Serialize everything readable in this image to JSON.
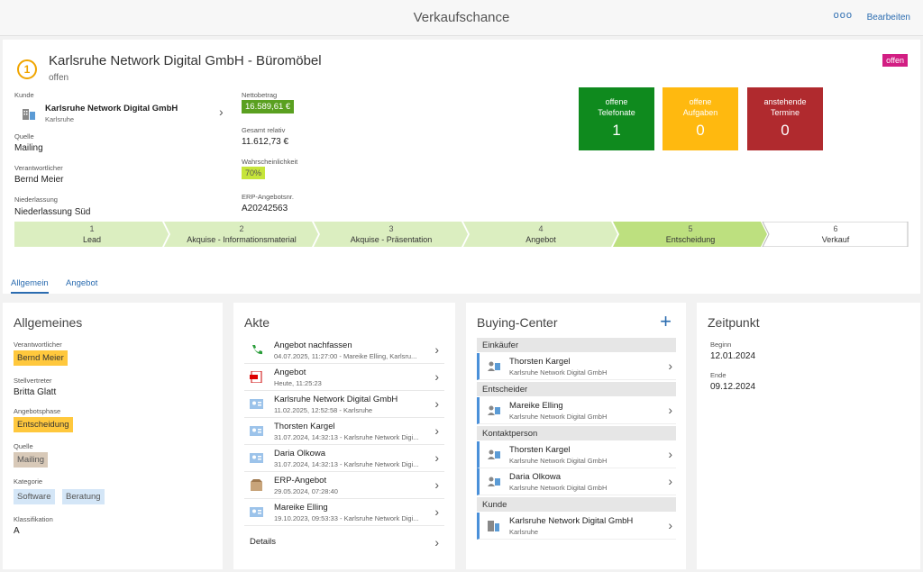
{
  "topbar": {
    "title": "Verkaufschance",
    "more": "ooo",
    "edit": "Bearbeiten"
  },
  "header": {
    "step_icon": "1",
    "title": "Karlsruhe Network Digital GmbH - Büromöbel",
    "status": "offen",
    "badge": "offen",
    "kunde_label": "Kunde",
    "kunde_name": "Karlsruhe Network Digital GmbH",
    "kunde_city": "Karlsruhe",
    "quelle_label": "Quelle",
    "quelle": "Mailing",
    "verantw_label": "Verantwortlicher",
    "verantw": "Bernd Meier",
    "niederl_label": "Niederlassung",
    "niederl": "Niederlassung Süd",
    "netto_label": "Nettobetrag",
    "netto": "16.589,61 €",
    "gesamt_label": "Gesamt relativ",
    "gesamt": "11.612,73 €",
    "wahr_label": "Wahrscheinlichkeit",
    "wahr": "70%",
    "erp_label": "ERP-Angebotsnr.",
    "erp": "A20242563"
  },
  "tiles": [
    {
      "l1": "offene",
      "l2": "Telefonate",
      "n": "1",
      "color": "#0f8a1e"
    },
    {
      "l1": "offene",
      "l2": "Aufgaben",
      "n": "0",
      "color": "#ffb90f"
    },
    {
      "l1": "anstehende",
      "l2": "Termine",
      "n": "0",
      "color": "#b02a2e"
    }
  ],
  "steps": [
    {
      "num": "1",
      "name": "Lead"
    },
    {
      "num": "2",
      "name": "Akquise - Informationsmaterial"
    },
    {
      "num": "3",
      "name": "Akquise - Präsentation"
    },
    {
      "num": "4",
      "name": "Angebot"
    },
    {
      "num": "5",
      "name": "Entscheidung"
    },
    {
      "num": "6",
      "name": "Verkauf"
    }
  ],
  "tabs": {
    "t1": "Allgemein",
    "t2": "Angebot"
  },
  "allgemeines": {
    "title": "Allgemeines",
    "verantw_label": "Verantwortlicher",
    "verantw": "Bernd Meier",
    "stellv_label": "Stellvertreter",
    "stellv": "Britta Glatt",
    "phase_label": "Angebotsphase",
    "phase": "Entscheidung",
    "quelle_label": "Quelle",
    "quelle": "Mailing",
    "kat_label": "Kategorie",
    "kat1": "Software",
    "kat2": "Beratung",
    "klass_label": "Klassifikation",
    "klass": "A"
  },
  "akte": {
    "title": "Akte",
    "details": "Details",
    "items": [
      {
        "name": "Angebot nachfassen",
        "detail": "04.07.2025, 11:27:00 - Mareike Elling, Karlsru...",
        "icon": "phone-icon"
      },
      {
        "name": "Angebot",
        "detail": "Heute, 11:25:23",
        "icon": "pdf-icon"
      },
      {
        "name": "Karlsruhe Network Digital GmbH",
        "detail": "11.02.2025, 12:52:58 - Karlsruhe",
        "icon": "contact-card-icon"
      },
      {
        "name": "Thorsten Kargel",
        "detail": "31.07.2024, 14:32:13 - Karlsruhe Network Digi...",
        "icon": "contact-card-icon"
      },
      {
        "name": "Daria Olkowa",
        "detail": "31.07.2024, 14:32:13 - Karlsruhe Network Digi...",
        "icon": "contact-card-icon"
      },
      {
        "name": "ERP-Angebot",
        "detail": "29.05.2024, 07:28:40",
        "icon": "box-icon"
      },
      {
        "name": "Mareike Elling",
        "detail": "19.10.2023, 09:53:33 - Karlsruhe Network Digi...",
        "icon": "contact-card-icon"
      }
    ]
  },
  "buying": {
    "title": "Buying-Center",
    "add": "+",
    "s1": "Einkäufer",
    "s2": "Entscheider",
    "s3": "Kontaktperson",
    "s4": "Kunde",
    "p1": {
      "name": "Thorsten Kargel",
      "org": "Karlsruhe Network Digital GmbH"
    },
    "p2": {
      "name": "Mareike Elling",
      "org": "Karlsruhe Network Digital GmbH"
    },
    "p3": {
      "name": "Thorsten Kargel",
      "org": "Karlsruhe Network Digital GmbH"
    },
    "p4": {
      "name": "Daria Olkowa",
      "org": "Karlsruhe Network Digital GmbH"
    },
    "p5": {
      "name": "Karlsruhe Network Digital GmbH",
      "org": "Karlsruhe"
    }
  },
  "zeitpunkt": {
    "title": "Zeitpunkt",
    "beginn_label": "Beginn",
    "beginn": "12.01.2024",
    "ende_label": "Ende",
    "ende": "09.12.2024"
  }
}
